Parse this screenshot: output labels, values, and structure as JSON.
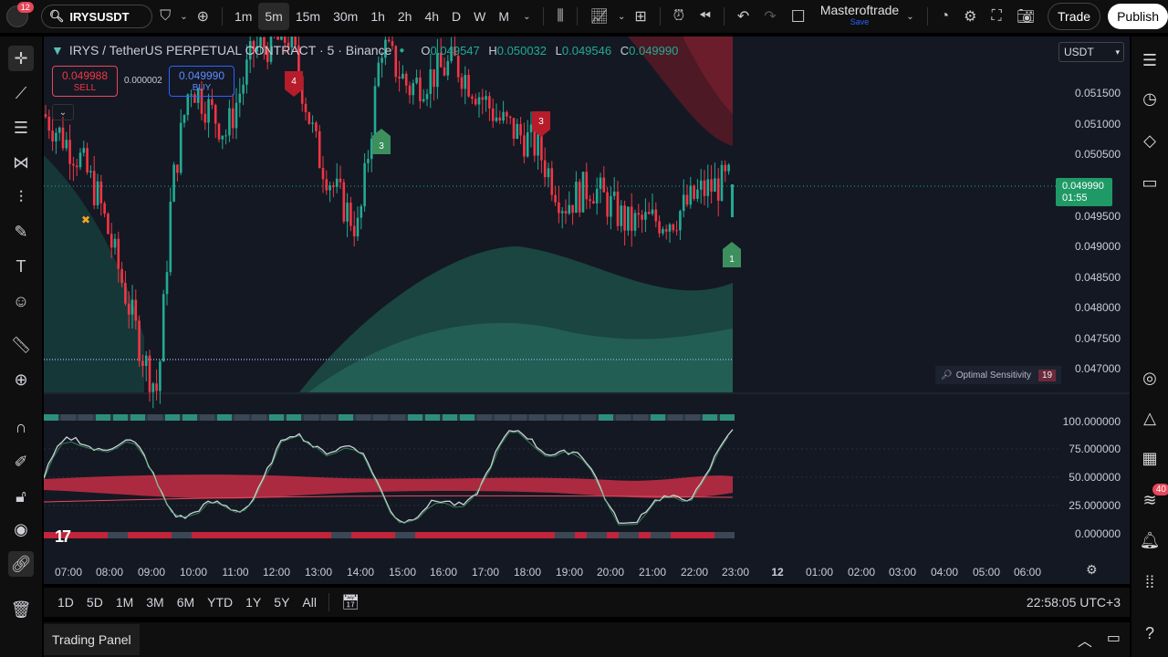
{
  "topbar": {
    "notif_count": "12",
    "symbol": "IRYSUSDT",
    "timeframes": [
      "1m",
      "5m",
      "15m",
      "30m",
      "1h",
      "2h",
      "4h",
      "D",
      "W",
      "M"
    ],
    "active_timeframe": "5m",
    "layout_name": "Masteroftrade",
    "layout_status": "Save",
    "trade_label": "Trade",
    "publish_label": "Publish"
  },
  "legend": {
    "title": "IRYS / TetherUS PERPETUAL CONTRACT · 5 · Binance",
    "o_label": "O",
    "o": "0.049547",
    "h_label": "H",
    "h": "0.050032",
    "l_label": "L",
    "l": "0.049546",
    "c_label": "C",
    "c": "0.049990"
  },
  "order": {
    "sell_price": "0.049988",
    "sell_label": "SELL",
    "spread": "0.000002",
    "buy_price": "0.049990",
    "buy_label": "BUY"
  },
  "currency": "USDT",
  "price_axis": [
    "0.051500",
    "0.051000",
    "0.050500",
    "0.049500",
    "0.049000",
    "0.048500",
    "0.048000",
    "0.047500",
    "0.047000"
  ],
  "current_price": {
    "value": "0.049990",
    "countdown": "01:55"
  },
  "osc_axis": [
    "100.000000",
    "75.000000",
    "50.000000",
    "25.000000",
    "0.000000"
  ],
  "time_axis": [
    "07:00",
    "08:00",
    "09:00",
    "10:00",
    "11:00",
    "12:00",
    "13:00",
    "14:00",
    "15:00",
    "16:00",
    "17:00",
    "18:00",
    "19:00",
    "20:00",
    "21:00",
    "22:00",
    "23:00",
    "12",
    "01:00",
    "02:00",
    "03:00",
    "04:00",
    "05:00",
    "06:00"
  ],
  "markers": [
    {
      "label": "4",
      "kind": "sell"
    },
    {
      "label": "3",
      "kind": "buy"
    },
    {
      "label": "3",
      "kind": "sell"
    },
    {
      "label": "1",
      "kind": "buy"
    }
  ],
  "optimal_sensitivity": {
    "label": "Optimal Sensitivity",
    "value": "19"
  },
  "ranges": [
    "1D",
    "5D",
    "1M",
    "3M",
    "6M",
    "YTD",
    "1Y",
    "5Y",
    "All"
  ],
  "clock": "22:58:05 UTC+3",
  "panel": {
    "tab_label": "Trading Panel"
  },
  "right_badge": "40",
  "colors": {
    "up": "#22ab94",
    "down": "#f23645",
    "buy_tag": "#3d8f5e",
    "sell_tag": "#b71c2a",
    "accent": "#2962ff"
  },
  "chart_data": {
    "type": "candlestick",
    "title": "IRYS / TetherUS PERPETUAL CONTRACT · 5 · Binance",
    "x_range": [
      "07:00",
      "23:00"
    ],
    "ylim": [
      0.0467,
      0.0522
    ],
    "last_close": 0.04999,
    "oscillator_ylim": [
      0,
      100
    ]
  }
}
